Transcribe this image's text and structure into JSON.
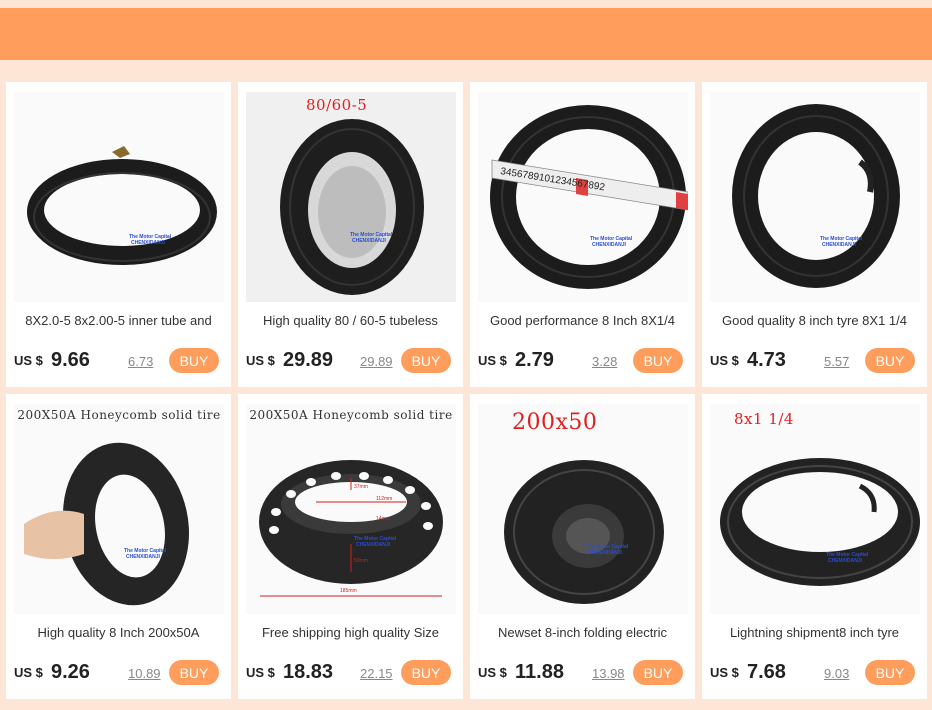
{
  "colors": {
    "accent": "#fe9d5c",
    "background": "#fde6d6"
  },
  "products": [
    {
      "title": "8X2.0-5 8x2.00-5 inner tube and",
      "currency": "US $",
      "price": "9.66",
      "old_price": "6.73",
      "buy": "BUY",
      "image_caption": "",
      "image": "inner-tube-image"
    },
    {
      "title": "High quality 80 / 60-5 tubeless",
      "currency": "US $",
      "price": "29.89",
      "old_price": "29.89",
      "buy": "BUY",
      "image_caption": "80/60-5",
      "image": "tubeless-tire-image"
    },
    {
      "title": "Good performance    8 Inch 8X1/4",
      "currency": "US $",
      "price": "2.79",
      "old_price": "3.28",
      "buy": "BUY",
      "image_caption": "",
      "image": "tire-with-ruler-image"
    },
    {
      "title": "Good quality 8 inch tyre 8X1 1/4",
      "currency": "US $",
      "price": "4.73",
      "old_price": "5.57",
      "buy": "BUY",
      "image_caption": "",
      "image": "tire-and-tube-image"
    },
    {
      "title": "High quality 8 Inch 200x50A",
      "currency": "US $",
      "price": "9.26",
      "old_price": "10.89",
      "buy": "BUY",
      "image_caption": "200X50A Honeycomb solid tire",
      "image": "honeycomb-tire-hand-image"
    },
    {
      "title": "Free  shipping high quality Size",
      "currency": "US $",
      "price": "18.83",
      "old_price": "22.15",
      "buy": "BUY",
      "image_caption": "200X50A Honeycomb solid tire",
      "image": "honeycomb-tire-dimensions-image"
    },
    {
      "title": "Newset 8-inch  folding electric",
      "currency": "US $",
      "price": "11.88",
      "old_price": "13.98",
      "buy": "BUY",
      "image_caption": "200x50",
      "image": "tire-200x50-image"
    },
    {
      "title": "Lightning shipment8 inch tyre",
      "currency": "US $",
      "price": "7.68",
      "old_price": "9.03",
      "buy": "BUY",
      "image_caption": "8x1 1/4",
      "image": "tire-8x1-image"
    }
  ],
  "ruler_text": "3456789101234567892",
  "watermark": "The Motor Capital CHENXIDANJI",
  "dimension_labels": [
    "37mm",
    "112mm",
    "14mm",
    "50mm",
    "185mm"
  ]
}
